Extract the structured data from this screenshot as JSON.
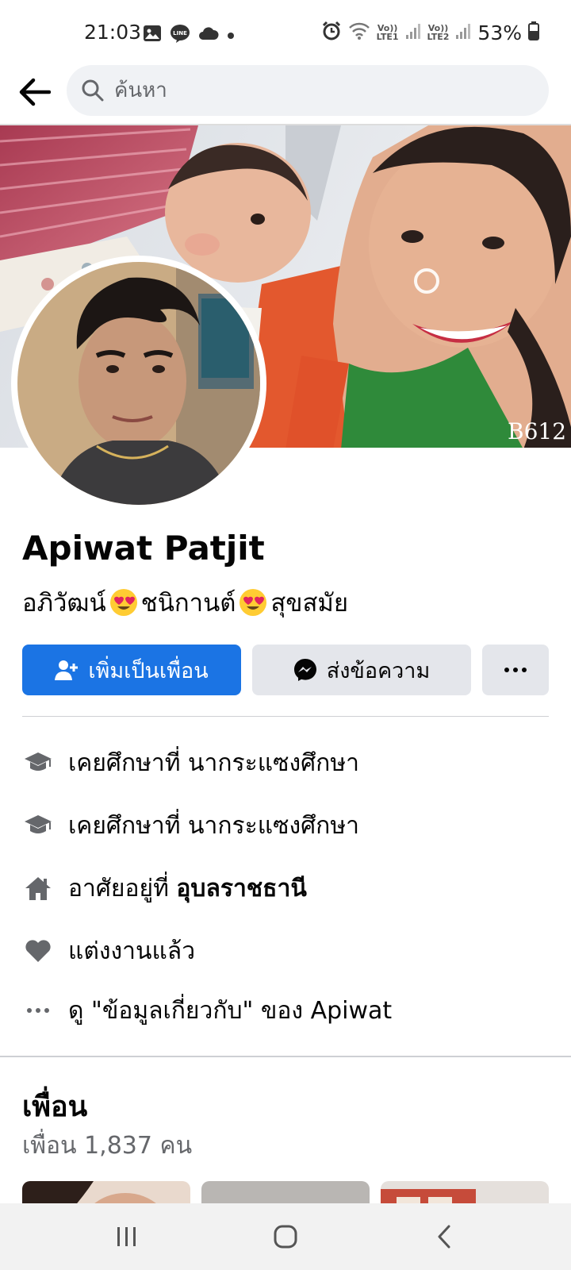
{
  "status_bar": {
    "time": "21:03",
    "battery": "53%",
    "sim1": "LTE1",
    "sim2": "LTE2",
    "volte": "Vo))"
  },
  "search": {
    "placeholder": "ค้นหา"
  },
  "profile": {
    "name": "Apiwat Patjit",
    "bio_part1": "อภิวัฒน์",
    "bio_part2": "ชนิกานต์",
    "bio_part3": "สุขสมัย",
    "bio_emoji": "heart-eyes-emoji"
  },
  "actions": {
    "add_friend": "เพิ่มเป็นเพื่อน",
    "message": "ส่งข้อความ"
  },
  "details": {
    "studied_1": "เคยศึกษาที่ นากระแซงศึกษา",
    "studied_2": "เคยศึกษาที่ นากระแซงศึกษา",
    "lives_prefix": "อาศัยอยู่ที่ ",
    "lives_place": "อุบลราชธานี",
    "relationship": "แต่งงานแล้ว",
    "see_about": "ดู \"ข้อมูลเกี่ยวกับ\" ของ Apiwat"
  },
  "friends": {
    "title": "เพื่อน",
    "count": "เพื่อน 1,837 คน"
  },
  "cover": {
    "watermark": "B612"
  },
  "colors": {
    "accent": "#1b74e4",
    "secondary_button": "#e4e6eb",
    "muted_text": "#65676b"
  }
}
